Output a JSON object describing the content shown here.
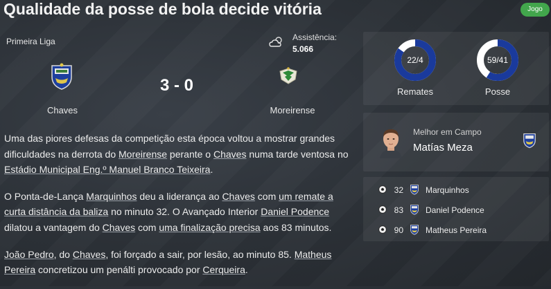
{
  "headline": "Qualidade da posse de bola decide vitória",
  "badge_label": "Jogo",
  "match": {
    "league": "Primeira Liga",
    "attendance_label": "Assistência:",
    "attendance_value": "5.066",
    "score": "3 - 0",
    "home_team": "Chaves",
    "away_team": "Moreirense",
    "home_crest_icon": "chaves-crest-icon",
    "away_crest_icon": "moreirense-crest-icon",
    "weather_icon": "cloudy-weather-icon"
  },
  "report": {
    "p1": [
      {
        "t": "Uma das piores defesas da competição esta época voltou a mostrar grandes dificuldades na derrota do "
      },
      {
        "t": "Moreirense",
        "link": true
      },
      {
        "t": " perante o "
      },
      {
        "t": "Chaves",
        "link": true
      },
      {
        "t": " numa tarde ventosa no "
      },
      {
        "t": "Estádio Municipal Eng.º Manuel Branco Teixeira",
        "link": true
      },
      {
        "t": "."
      }
    ],
    "p2": [
      {
        "t": "O Ponta-de-Lança "
      },
      {
        "t": "Marquinhos",
        "link": true
      },
      {
        "t": " deu a liderança ao "
      },
      {
        "t": "Chaves",
        "link": true
      },
      {
        "t": " com "
      },
      {
        "t": "um remate a curta distância da baliza",
        "link": true
      },
      {
        "t": " no minuto 32. O Avançado Interior "
      },
      {
        "t": "Daniel Podence",
        "link": true
      },
      {
        "t": " dilatou a vantagem do "
      },
      {
        "t": "Chaves",
        "link": true
      },
      {
        "t": " com "
      },
      {
        "t": "uma finalização precisa",
        "link": true
      },
      {
        "t": " aos 83 minutos."
      }
    ],
    "p3": [
      {
        "t": "João Pedro",
        "link": true
      },
      {
        "t": ", do "
      },
      {
        "t": "Chaves",
        "link": true
      },
      {
        "t": ", foi forçado a sair, por lesão, ao minuto 85. "
      },
      {
        "t": "Matheus Pereira",
        "link": true
      },
      {
        "t": " concretizou um penálti provocado por "
      },
      {
        "t": "Cerqueira",
        "link": true
      },
      {
        "t": "."
      }
    ]
  },
  "stats": {
    "shots": {
      "label": "Remates",
      "text": "22/4",
      "home": 22,
      "away": 4
    },
    "possession": {
      "label": "Posse",
      "text": "59/41",
      "home": 59,
      "away": 41
    },
    "home_color": "#1a3a9c",
    "away_color": "#ffffff"
  },
  "man_of_match": {
    "label": "Melhor em Campo",
    "name": "Matías Meza",
    "photo_icon": "player-photo",
    "crest_icon": "chaves-crest-icon"
  },
  "goals": [
    {
      "minute": "32",
      "player": "Marquinhos"
    },
    {
      "minute": "83",
      "player": "Daniel Podence"
    },
    {
      "minute": "90",
      "player": "Matheus Pereira"
    }
  ]
}
